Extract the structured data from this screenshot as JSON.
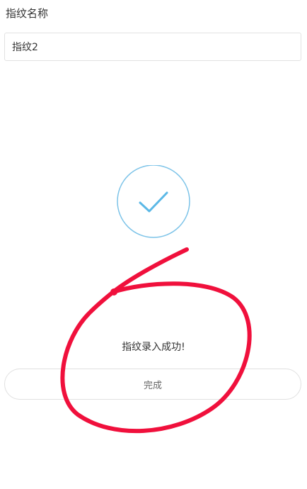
{
  "name_section": {
    "label": "指纹名称",
    "value": "指纹2"
  },
  "status": {
    "icon": "checkmark-circle-icon",
    "message": "指纹录入成功!"
  },
  "actions": {
    "done_label": "完成"
  },
  "colors": {
    "check_accent": "#5bb8e6",
    "annotation_red": "#f0103c"
  }
}
